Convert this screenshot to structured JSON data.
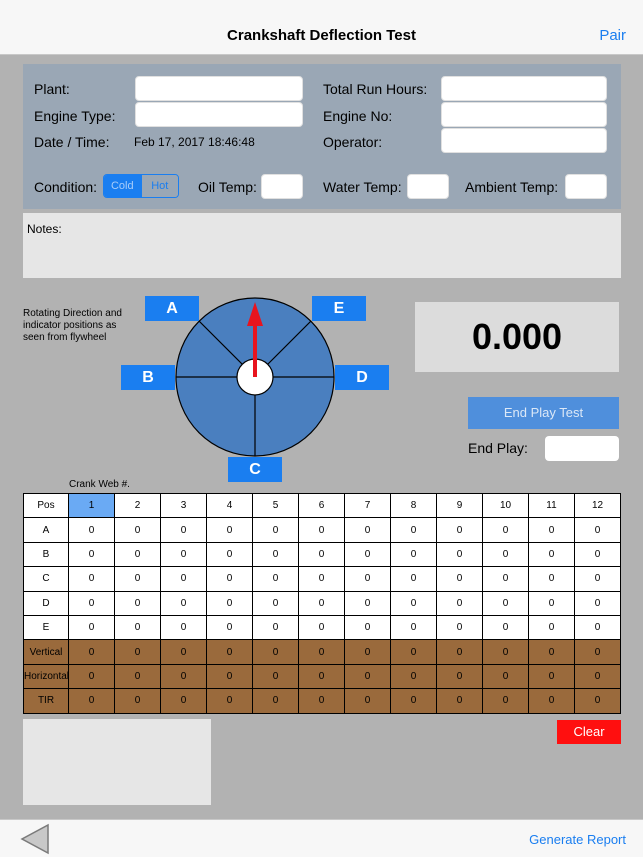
{
  "nav": {
    "title": "Crankshaft Deflection Test",
    "pair": "Pair"
  },
  "form": {
    "plant": "Plant:",
    "engine_type": "Engine Type:",
    "date_time": "Date / Time:",
    "date_value": "Feb 17, 2017 18:46:48",
    "total_run_hours": "Total Run Hours:",
    "engine_no": "Engine No:",
    "operator": "Operator:",
    "condition": "Condition:",
    "cold": "Cold",
    "hot": "Hot",
    "oil_temp": "Oil Temp:",
    "water_temp": "Water Temp:",
    "ambient_temp": "Ambient Temp:"
  },
  "notes": {
    "label": "Notes:"
  },
  "diagram": {
    "caption": "Rotating Direction and indicator positions as seen from flywheel",
    "positions": {
      "A": "A",
      "B": "B",
      "C": "C",
      "D": "D",
      "E": "E"
    },
    "wheel_color": "#4a7fbf",
    "arrow_color": "#e8141e"
  },
  "readout": {
    "value": "0.000"
  },
  "end_play": {
    "button": "End Play Test",
    "label": "End Play:"
  },
  "table": {
    "caption": "Crank Web #.",
    "header_label": "Pos",
    "columns": [
      "1",
      "2",
      "3",
      "4",
      "5",
      "6",
      "7",
      "8",
      "9",
      "10",
      "11",
      "12"
    ],
    "rows": [
      {
        "label": "A",
        "values": [
          "0",
          "0",
          "0",
          "0",
          "0",
          "0",
          "0",
          "0",
          "0",
          "0",
          "0",
          "0"
        ]
      },
      {
        "label": "B",
        "values": [
          "0",
          "0",
          "0",
          "0",
          "0",
          "0",
          "0",
          "0",
          "0",
          "0",
          "0",
          "0"
        ]
      },
      {
        "label": "C",
        "values": [
          "0",
          "0",
          "0",
          "0",
          "0",
          "0",
          "0",
          "0",
          "0",
          "0",
          "0",
          "0"
        ]
      },
      {
        "label": "D",
        "values": [
          "0",
          "0",
          "0",
          "0",
          "0",
          "0",
          "0",
          "0",
          "0",
          "0",
          "0",
          "0"
        ]
      },
      {
        "label": "E",
        "values": [
          "0",
          "0",
          "0",
          "0",
          "0",
          "0",
          "0",
          "0",
          "0",
          "0",
          "0",
          "0"
        ]
      }
    ],
    "summary_rows": [
      {
        "label": "Vertical",
        "values": [
          "0",
          "0",
          "0",
          "0",
          "0",
          "0",
          "0",
          "0",
          "0",
          "0",
          "0",
          "0"
        ]
      },
      {
        "label": "Horizontal",
        "values": [
          "0",
          "0",
          "0",
          "0",
          "0",
          "0",
          "0",
          "0",
          "0",
          "0",
          "0",
          "0"
        ]
      },
      {
        "label": "TIR",
        "values": [
          "0",
          "0",
          "0",
          "0",
          "0",
          "0",
          "0",
          "0",
          "0",
          "0",
          "0",
          "0"
        ]
      }
    ],
    "summary_color": "#9a6a3c",
    "selected_column": "1"
  },
  "actions": {
    "clear": "Clear",
    "generate_report": "Generate Report"
  }
}
